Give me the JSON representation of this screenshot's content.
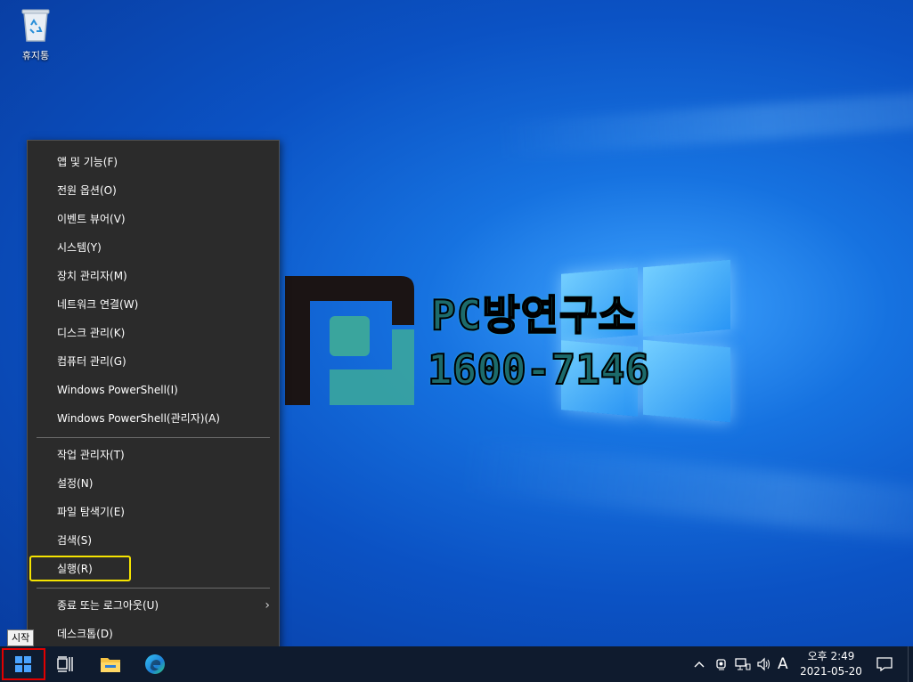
{
  "desktop": {
    "recycle_bin_label": "휴지통",
    "watermark_line1": "PC방연구소",
    "watermark_line2": "1600-7146"
  },
  "context_menu": {
    "items_group1": [
      "앱 및 기능(F)",
      "전원 옵션(O)",
      "이벤트 뷰어(V)",
      "시스템(Y)",
      "장치 관리자(M)",
      "네트워크 연결(W)",
      "디스크 관리(K)",
      "컴퓨터 관리(G)",
      "Windows PowerShell(I)",
      "Windows PowerShell(관리자)(A)"
    ],
    "items_group2": [
      "작업 관리자(T)",
      "설정(N)",
      "파일 탐색기(E)",
      "검색(S)",
      "실행(R)"
    ],
    "items_group3": [
      "종료 또는 로그아웃(U)",
      "데스크톱(D)"
    ],
    "highlight_color": "#f5e400"
  },
  "tooltip": {
    "text": "시작"
  },
  "taskbar": {
    "start_highlight_color": "#e00000",
    "input_indicator": "A",
    "time": "오후 2:49",
    "date": "2021-05-20",
    "icons": [
      "start-icon",
      "task-view-icon",
      "file-explorer-icon",
      "edge-icon",
      "chevron-up-icon",
      "meet-now-icon",
      "network-icon",
      "volume-icon",
      "notification-icon"
    ]
  }
}
